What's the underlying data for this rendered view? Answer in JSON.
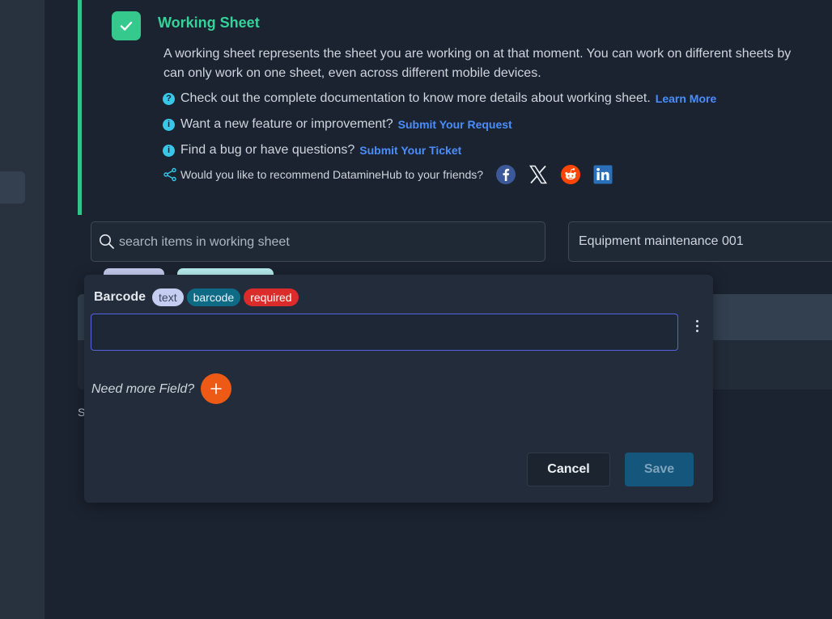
{
  "info": {
    "title": "Working Sheet",
    "desc_line1": "A working sheet represents the sheet you are working on at that moment. You can work on different sheets by",
    "desc_line2": "can only work on one sheet, even across different mobile devices.",
    "docs_text": "Check out the complete documentation to know more details about working sheet.",
    "docs_link": "Learn More",
    "feature_text": "Want a new feature or improvement?",
    "feature_link": "Submit Your Request",
    "bug_text": "Find a bug or have questions?",
    "bug_link": "Submit Your Ticket",
    "share_text": "Would you like to recommend DatamineHub to your friends?",
    "social_icons": [
      "facebook-icon",
      "x-icon",
      "reddit-icon",
      "linkedin-icon"
    ],
    "accent_color": "#34d399"
  },
  "search": {
    "placeholder": "search items in working sheet",
    "value": ""
  },
  "sheet": {
    "selected": "Equipment maintenance 001"
  },
  "behind": {
    "s_text": "S"
  },
  "modal": {
    "field_label": "Barcode",
    "badges": [
      "text",
      "barcode",
      "required"
    ],
    "field_value": "",
    "more_label": "Need more Field?",
    "cancel_label": "Cancel",
    "save_label": "Save"
  },
  "colors": {
    "add_button": "#ec5a16",
    "required_badge": "#db2b2b",
    "save_button": "#15577c"
  }
}
